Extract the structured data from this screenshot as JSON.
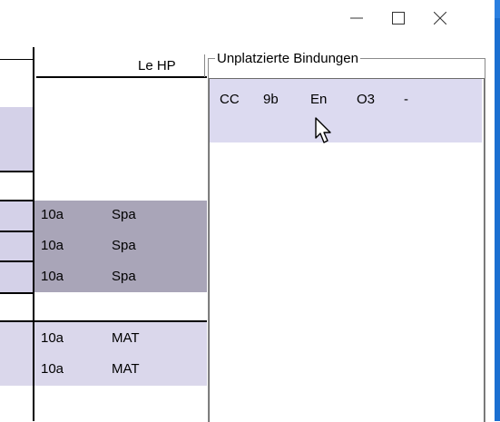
{
  "window": {
    "minimize_glyph": "—",
    "maximize_glyph": "☐",
    "close_glyph": "✕"
  },
  "timetable": {
    "header": "Le HP",
    "rows": [
      {
        "klasse": "10a",
        "fach": "Spa"
      },
      {
        "klasse": "10a",
        "fach": "Spa"
      },
      {
        "klasse": "10a",
        "fach": "Spa"
      },
      {
        "klasse": "10a",
        "fach": "MAT"
      },
      {
        "klasse": "10a",
        "fach": "MAT"
      }
    ]
  },
  "unplaced": {
    "title": "Unplatzierte Bindungen",
    "items": [
      {
        "c1": "CC",
        "c2": "9b",
        "c3": "En",
        "c4": "O3",
        "c5": "-"
      }
    ]
  },
  "colors": {
    "band_gray": "#a9a5b8",
    "band_lavender": "#d4d1e8",
    "selection": "#dcdaf0",
    "window_edge": "#1b6fd1"
  }
}
